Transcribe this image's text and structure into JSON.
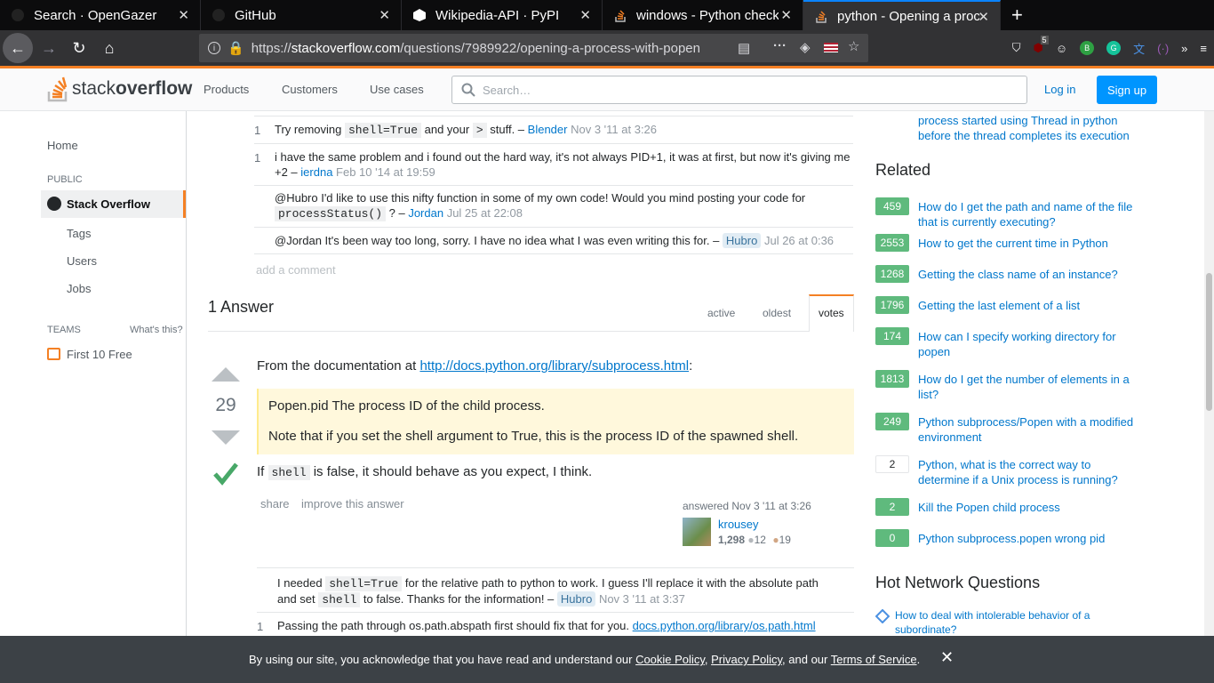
{
  "browser": {
    "tabs": [
      {
        "title": "Search · OpenGazer",
        "icon": "github-icon"
      },
      {
        "title": "GitHub",
        "icon": "github-icon"
      },
      {
        "title": "Wikipedia-API · PyPI",
        "icon": "pypi-icon"
      },
      {
        "title": "windows - Python check i",
        "icon": "stackoverflow-icon"
      },
      {
        "title": "python - Opening a proce",
        "icon": "stackoverflow-icon"
      }
    ],
    "url_prefix": "https://",
    "url_host": "stackoverflow.com",
    "url_path": "/questions/7989922/opening-a-process-with-popen",
    "ublock_count": "5"
  },
  "header": {
    "logo_light": "stack",
    "logo_bold": "overflow",
    "nav": [
      "Products",
      "Customers",
      "Use cases"
    ],
    "search_placeholder": "Search…",
    "login": "Log in",
    "signup": "Sign up"
  },
  "sidebar": {
    "home": "Home",
    "public_label": "PUBLIC",
    "stackoverflow": "Stack Overflow",
    "tags": "Tags",
    "users": "Users",
    "jobs": "Jobs",
    "teams_label": "TEAMS",
    "whats_this": "What's this?",
    "first_free": "First 10 Free"
  },
  "question_comments": [
    {
      "score": "1",
      "pre": "Try removing ",
      "code1": "shell=True",
      "mid": " and your ",
      "code2": ">",
      "post": " stuff. – ",
      "user": "Blender",
      "date": "Nov 3 '11 at 3:26"
    },
    {
      "score": "1",
      "text": "i have the same problem and i found out the hard way, it's not always PID+1, it was at first, but now it's giving me +2 – ",
      "user": "ierdna",
      "date": "Feb 10 '14 at 19:59"
    },
    {
      "score": "",
      "text": "@Hubro I'd like to use this nifty function in some of my own code! Would you mind posting your code for ",
      "code": "processStatus()",
      "post": " ? – ",
      "user": "Jordan",
      "date": "Jul 25 at 22:08"
    },
    {
      "score": "",
      "text": "@Jordan It's been way too long, sorry. I have no idea what I was even writing this for. – ",
      "user": "Hubro",
      "date": "Jul 26 at 0:36"
    }
  ],
  "add_comment": "add a comment",
  "answers": {
    "heading": "1 Answer",
    "sort_tabs": [
      "active",
      "oldest",
      "votes"
    ],
    "votes": "29",
    "intro": "From the documentation at ",
    "doc_link": "http://docs.python.org/library/subprocess.html",
    "intro_end": ":",
    "quote1": "Popen.pid The process ID of the child process.",
    "quote2": "Note that if you set the shell argument to True, this is the process ID of the spawned shell.",
    "if_pre": "If ",
    "if_code": "shell",
    "if_post": " is false, it should behave as you expect, I think.",
    "share": "share",
    "improve": "improve this answer",
    "answered": "answered Nov 3 '11 at 3:26",
    "author": "krousey",
    "rep": "1,298",
    "silver": "12",
    "bronze": "19"
  },
  "answer_comments": [
    {
      "score": "",
      "pre": "I needed ",
      "code1": "shell=True",
      "mid": " for the relative path to python to work. I guess I'll replace it with the absolute path and set ",
      "code2": "shell",
      "post": " to false. Thanks for the information! – ",
      "user": "Hubro",
      "date": "Nov 3 '11 at 3:37"
    },
    {
      "score": "1",
      "text": "Passing the path through os.path.abspath first should fix that for you. ",
      "link": "docs.python.org/library/os.path.html"
    }
  ],
  "right": {
    "prev_link": "process started using Thread in python before the thread completes its execution",
    "related_title": "Related",
    "related": [
      {
        "count": "459",
        "title": "How do I get the path and name of the file that is currently executing?",
        "accepted": true
      },
      {
        "count": "2553",
        "title": "How to get the current time in Python",
        "accepted": true
      },
      {
        "count": "1268",
        "title": "Getting the class name of an instance?",
        "accepted": true
      },
      {
        "count": "1796",
        "title": "Getting the last element of a list",
        "accepted": true
      },
      {
        "count": "174",
        "title": "How can I specify working directory for popen",
        "accepted": true
      },
      {
        "count": "1813",
        "title": "How do I get the number of elements in a list?",
        "accepted": true
      },
      {
        "count": "249",
        "title": "Python subprocess/Popen with a modified environment",
        "accepted": true
      },
      {
        "count": "2",
        "title": "Python, what is the correct way to determine if a Unix process is running?",
        "accepted": false
      },
      {
        "count": "2",
        "title": "Kill the Popen child process",
        "accepted": true
      },
      {
        "count": "0",
        "title": "Python subprocess.popen wrong pid",
        "accepted": true
      }
    ],
    "hnq_title": "Hot Network Questions",
    "hnq_item": "How to deal with intolerable behavior of a subordinate?"
  },
  "cookie": {
    "pre": "By using our site, you acknowledge that you have read and understand our ",
    "cookie_policy": "Cookie Policy",
    "sep": ", ",
    "privacy_policy": "Privacy Policy",
    "and": ", and our ",
    "terms": "Terms of Service",
    "end": "."
  },
  "colors": {
    "accent": "#f48024",
    "link": "#0077cc",
    "accepted": "#5fba7d",
    "button": "#0095ff"
  }
}
